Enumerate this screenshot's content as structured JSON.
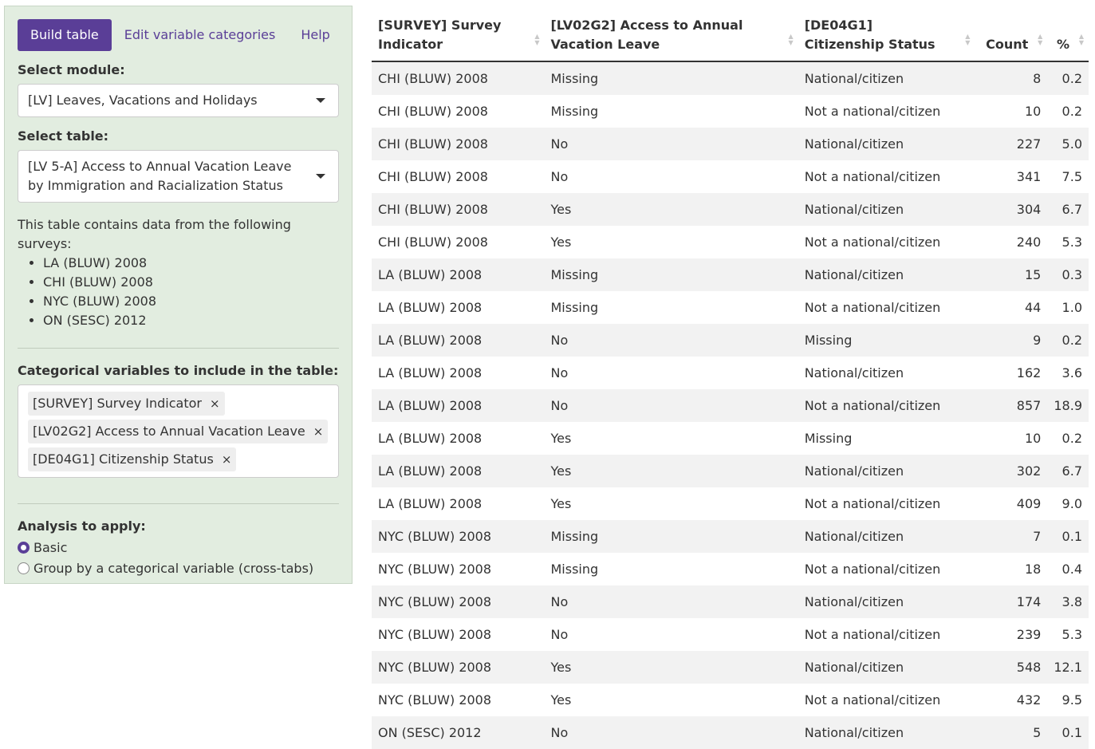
{
  "tabs": [
    "Build table",
    "Edit variable categories",
    "Help"
  ],
  "module": {
    "label": "Select module:",
    "value": "[LV] Leaves, Vacations and Holidays"
  },
  "table_select": {
    "label": "Select table:",
    "value": "[LV 5-A] Access to Annual Vacation Leave by Immigration and Racialization Status"
  },
  "surveys": {
    "intro": "This table contains data from the following surveys:",
    "items": [
      "LA (BLUW) 2008",
      "CHI (BLUW) 2008",
      "NYC (BLUW) 2008",
      "ON (SESC) 2012"
    ]
  },
  "variables": {
    "label": "Categorical variables to include in the table:",
    "chips": [
      "[SURVEY] Survey Indicator",
      "[LV02G2] Access to Annual Vacation Leave",
      "[DE04G1] Citizenship Status"
    ],
    "remove_glyph": "×"
  },
  "analysis": {
    "label": "Analysis to apply:",
    "options": [
      "Basic",
      "Group by a categorical variable (cross-tabs)"
    ],
    "selected": "Basic"
  },
  "table": {
    "headers": [
      "[SURVEY] Survey Indicator",
      "[LV02G2] Access to Annual Vacation Leave",
      "[DE04G1] Citizenship Status",
      "Count",
      "%"
    ],
    "rows": [
      [
        "CHI (BLUW) 2008",
        "Missing",
        "National/citizen",
        "8",
        "0.2"
      ],
      [
        "CHI (BLUW) 2008",
        "Missing",
        "Not a national/citizen",
        "10",
        "0.2"
      ],
      [
        "CHI (BLUW) 2008",
        "No",
        "National/citizen",
        "227",
        "5.0"
      ],
      [
        "CHI (BLUW) 2008",
        "No",
        "Not a national/citizen",
        "341",
        "7.5"
      ],
      [
        "CHI (BLUW) 2008",
        "Yes",
        "National/citizen",
        "304",
        "6.7"
      ],
      [
        "CHI (BLUW) 2008",
        "Yes",
        "Not a national/citizen",
        "240",
        "5.3"
      ],
      [
        "LA (BLUW) 2008",
        "Missing",
        "National/citizen",
        "15",
        "0.3"
      ],
      [
        "LA (BLUW) 2008",
        "Missing",
        "Not a national/citizen",
        "44",
        "1.0"
      ],
      [
        "LA (BLUW) 2008",
        "No",
        "Missing",
        "9",
        "0.2"
      ],
      [
        "LA (BLUW) 2008",
        "No",
        "National/citizen",
        "162",
        "3.6"
      ],
      [
        "LA (BLUW) 2008",
        "No",
        "Not a national/citizen",
        "857",
        "18.9"
      ],
      [
        "LA (BLUW) 2008",
        "Yes",
        "Missing",
        "10",
        "0.2"
      ],
      [
        "LA (BLUW) 2008",
        "Yes",
        "National/citizen",
        "302",
        "6.7"
      ],
      [
        "LA (BLUW) 2008",
        "Yes",
        "Not a national/citizen",
        "409",
        "9.0"
      ],
      [
        "NYC (BLUW) 2008",
        "Missing",
        "National/citizen",
        "7",
        "0.1"
      ],
      [
        "NYC (BLUW) 2008",
        "Missing",
        "Not a national/citizen",
        "18",
        "0.4"
      ],
      [
        "NYC (BLUW) 2008",
        "No",
        "National/citizen",
        "174",
        "3.8"
      ],
      [
        "NYC (BLUW) 2008",
        "No",
        "Not a national/citizen",
        "239",
        "5.3"
      ],
      [
        "NYC (BLUW) 2008",
        "Yes",
        "National/citizen",
        "548",
        "12.1"
      ],
      [
        "NYC (BLUW) 2008",
        "Yes",
        "Not a national/citizen",
        "432",
        "9.5"
      ],
      [
        "ON (SESC) 2012",
        "No",
        "National/citizen",
        "5",
        "0.1"
      ]
    ]
  },
  "colors": {
    "accent": "#5a3e97",
    "sidebar_bg": "#e2ede0",
    "row_stripe": "#f2f2f2"
  }
}
